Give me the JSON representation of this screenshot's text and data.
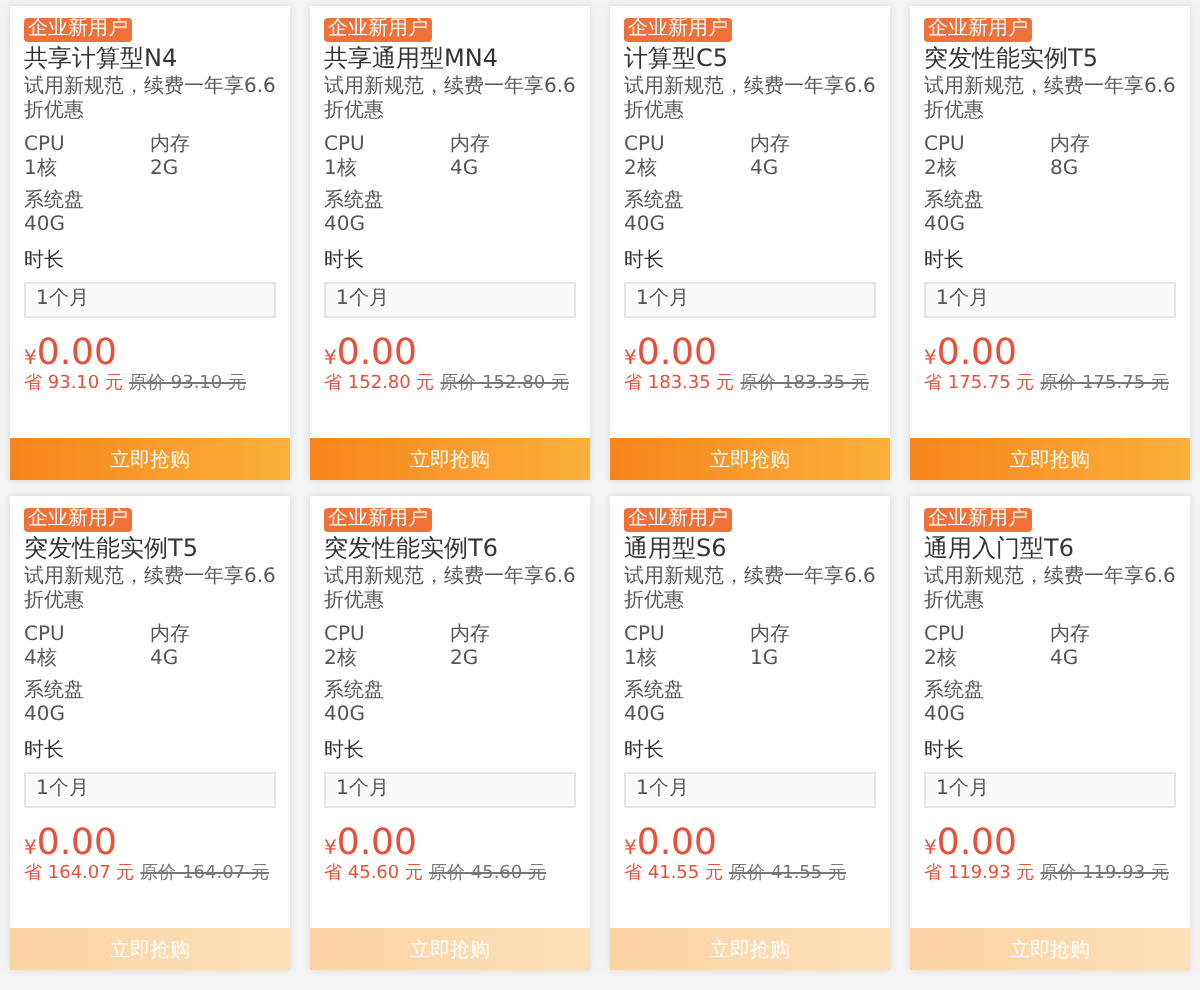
{
  "cards": [
    {
      "badge": "企业新用户",
      "title": "共享计算型N4",
      "subtitle": "试用新规范，续费一年享6.6折优惠",
      "specs": [
        {
          "label": "CPU",
          "value": "1核"
        },
        {
          "label": "内存",
          "value": "2G"
        },
        {
          "label": "系统盘",
          "value": "40G"
        }
      ],
      "duration_label": "时长",
      "duration": "1个月",
      "currency": "¥",
      "price": "0.00",
      "savings": "省 93.10 元",
      "original": "原价 93.10 元",
      "button": "立即抢购",
      "dimmed": false
    },
    {
      "badge": "企业新用户",
      "title": "共享通用型MN4",
      "subtitle": "试用新规范，续费一年享6.6折优惠",
      "specs": [
        {
          "label": "CPU",
          "value": "1核"
        },
        {
          "label": "内存",
          "value": "4G"
        },
        {
          "label": "系统盘",
          "value": "40G"
        }
      ],
      "duration_label": "时长",
      "duration": "1个月",
      "currency": "¥",
      "price": "0.00",
      "savings": "省 152.80 元",
      "original": "原价 152.80 元",
      "button": "立即抢购",
      "dimmed": false
    },
    {
      "badge": "企业新用户",
      "title": "计算型C5",
      "subtitle": "试用新规范，续费一年享6.6折优惠",
      "specs": [
        {
          "label": "CPU",
          "value": "2核"
        },
        {
          "label": "内存",
          "value": "4G"
        },
        {
          "label": "系统盘",
          "value": "40G"
        }
      ],
      "duration_label": "时长",
      "duration": "1个月",
      "currency": "¥",
      "price": "0.00",
      "savings": "省 183.35 元",
      "original": "原价 183.35 元",
      "button": "立即抢购",
      "dimmed": false
    },
    {
      "badge": "企业新用户",
      "title": "突发性能实例T5",
      "subtitle": "试用新规范，续费一年享6.6折优惠",
      "specs": [
        {
          "label": "CPU",
          "value": "2核"
        },
        {
          "label": "内存",
          "value": "8G"
        },
        {
          "label": "系统盘",
          "value": "40G"
        }
      ],
      "duration_label": "时长",
      "duration": "1个月",
      "currency": "¥",
      "price": "0.00",
      "savings": "省 175.75 元",
      "original": "原价 175.75 元",
      "button": "立即抢购",
      "dimmed": false
    },
    {
      "badge": "企业新用户",
      "title": "突发性能实例T5",
      "subtitle": "试用新规范，续费一年享6.6折优惠",
      "specs": [
        {
          "label": "CPU",
          "value": "4核"
        },
        {
          "label": "内存",
          "value": "4G"
        },
        {
          "label": "系统盘",
          "value": "40G"
        }
      ],
      "duration_label": "时长",
      "duration": "1个月",
      "currency": "¥",
      "price": "0.00",
      "savings": "省 164.07 元",
      "original": "原价 164.07 元",
      "button": "立即抢购",
      "dimmed": true
    },
    {
      "badge": "企业新用户",
      "title": "突发性能实例T6",
      "subtitle": "试用新规范，续费一年享6.6折优惠",
      "specs": [
        {
          "label": "CPU",
          "value": "2核"
        },
        {
          "label": "内存",
          "value": "2G"
        },
        {
          "label": "系统盘",
          "value": "40G"
        }
      ],
      "duration_label": "时长",
      "duration": "1个月",
      "currency": "¥",
      "price": "0.00",
      "savings": "省 45.60 元",
      "original": "原价 45.60 元",
      "button": "立即抢购",
      "dimmed": true
    },
    {
      "badge": "企业新用户",
      "title": "通用型S6",
      "subtitle": "试用新规范，续费一年享6.6折优惠",
      "specs": [
        {
          "label": "CPU",
          "value": "1核"
        },
        {
          "label": "内存",
          "value": "1G"
        },
        {
          "label": "系统盘",
          "value": "40G"
        }
      ],
      "duration_label": "时长",
      "duration": "1个月",
      "currency": "¥",
      "price": "0.00",
      "savings": "省 41.55 元",
      "original": "原价 41.55 元",
      "button": "立即抢购",
      "dimmed": true
    },
    {
      "badge": "企业新用户",
      "title": "通用入门型T6",
      "subtitle": "试用新规范，续费一年享6.6折优惠",
      "specs": [
        {
          "label": "CPU",
          "value": "2核"
        },
        {
          "label": "内存",
          "value": "4G"
        },
        {
          "label": "系统盘",
          "value": "40G"
        }
      ],
      "duration_label": "时长",
      "duration": "1个月",
      "currency": "¥",
      "price": "0.00",
      "savings": "省 119.93 元",
      "original": "原价 119.93 元",
      "button": "立即抢购",
      "dimmed": true
    }
  ]
}
